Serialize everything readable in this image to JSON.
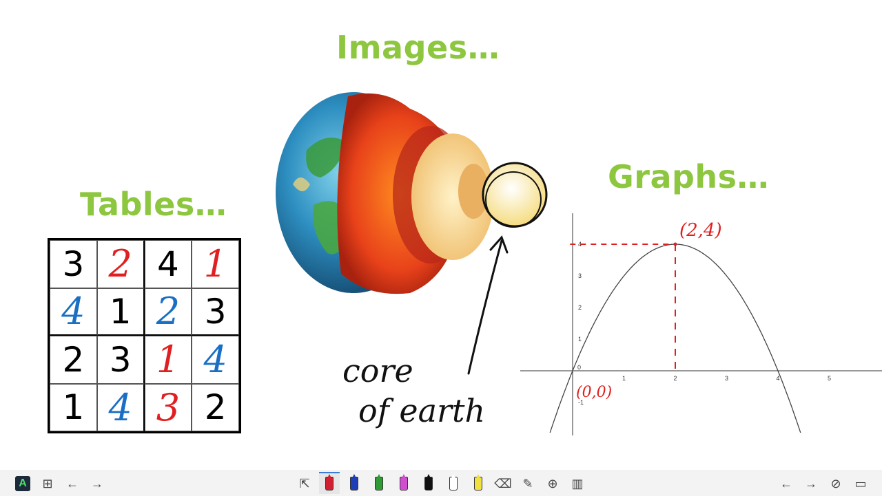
{
  "titles": {
    "images": "Images…",
    "tables": "Tables…",
    "graphs": "Graphs…"
  },
  "table": {
    "rows": [
      [
        {
          "v": "3",
          "color": "#000000",
          "hw": false
        },
        {
          "v": "2",
          "color": "#e02020",
          "hw": true
        },
        {
          "v": "4",
          "color": "#000000",
          "hw": false
        },
        {
          "v": "1",
          "color": "#e02020",
          "hw": true
        }
      ],
      [
        {
          "v": "4",
          "color": "#1a6fc4",
          "hw": true
        },
        {
          "v": "1",
          "color": "#000000",
          "hw": false
        },
        {
          "v": "2",
          "color": "#1a6fc4",
          "hw": true
        },
        {
          "v": "3",
          "color": "#000000",
          "hw": false
        }
      ],
      [
        {
          "v": "2",
          "color": "#000000",
          "hw": false
        },
        {
          "v": "3",
          "color": "#000000",
          "hw": false
        },
        {
          "v": "1",
          "color": "#e02020",
          "hw": true
        },
        {
          "v": "4",
          "color": "#1a6fc4",
          "hw": true
        }
      ],
      [
        {
          "v": "1",
          "color": "#000000",
          "hw": false
        },
        {
          "v": "4",
          "color": "#1a6fc4",
          "hw": true
        },
        {
          "v": "3",
          "color": "#e02020",
          "hw": true
        },
        {
          "v": "2",
          "color": "#000000",
          "hw": false
        }
      ]
    ]
  },
  "annotation": {
    "line1": "core",
    "line2": "of earth"
  },
  "graph": {
    "x_ticks": [
      "1",
      "2",
      "3",
      "4",
      "5"
    ],
    "y_ticks": [
      "1",
      "2",
      "3",
      "4"
    ],
    "neg_tick": "-1",
    "origin_label": "0",
    "vertex_label": "(2,4)",
    "origin_point_label": "(0,0)",
    "color_curve": "#444444",
    "color_annotation": "#e02020"
  },
  "chart_data": {
    "type": "line",
    "series": [
      {
        "x": [
          -0.44,
          0,
          1,
          2,
          3,
          4,
          4.44
        ],
        "y": [
          -1.95,
          0,
          3,
          4,
          3,
          0,
          -1.95
        ]
      }
    ],
    "xlim": [
      -0.5,
      6
    ],
    "ylim": [
      -1.2,
      4.5
    ],
    "annotations": [
      "(2,4)",
      "(0,0)"
    ]
  },
  "toolbar": {
    "left": [
      {
        "name": "app-logo-icon",
        "glyph": "A"
      },
      {
        "name": "pages-grid-icon",
        "glyph": "⊞"
      },
      {
        "name": "back-arrow-icon",
        "glyph": "←"
      },
      {
        "name": "forward-arrow-icon",
        "glyph": "→"
      }
    ],
    "center": [
      {
        "name": "select-cursor-icon",
        "type": "glyph",
        "glyph": "⇱"
      },
      {
        "name": "pen-red-icon",
        "type": "pen",
        "color": "#d02030",
        "active": true
      },
      {
        "name": "pen-blue-icon",
        "type": "pen",
        "color": "#1f3fb8"
      },
      {
        "name": "pen-green-icon",
        "type": "pen",
        "color": "#2e9b34"
      },
      {
        "name": "pen-pink-icon",
        "type": "pen",
        "color": "#d04fd0"
      },
      {
        "name": "pen-black-icon",
        "type": "pen",
        "color": "#111111"
      },
      {
        "name": "pen-white-icon",
        "type": "pen",
        "color": "#ffffff"
      },
      {
        "name": "highlighter-yellow-icon",
        "type": "pen",
        "color": "#f0e040"
      },
      {
        "name": "eraser-icon",
        "type": "glyph",
        "glyph": "⌫"
      },
      {
        "name": "laser-pointer-icon",
        "type": "glyph",
        "glyph": "✎"
      },
      {
        "name": "add-page-icon",
        "type": "glyph",
        "glyph": "⊕"
      },
      {
        "name": "chart-icon",
        "type": "glyph",
        "glyph": "▥"
      }
    ],
    "right": [
      {
        "name": "undo-arrow-icon",
        "glyph": "←"
      },
      {
        "name": "redo-arrow-icon",
        "glyph": "→"
      },
      {
        "name": "hide-eye-icon",
        "glyph": "⊘"
      },
      {
        "name": "screen-settings-icon",
        "glyph": "▭"
      }
    ]
  }
}
